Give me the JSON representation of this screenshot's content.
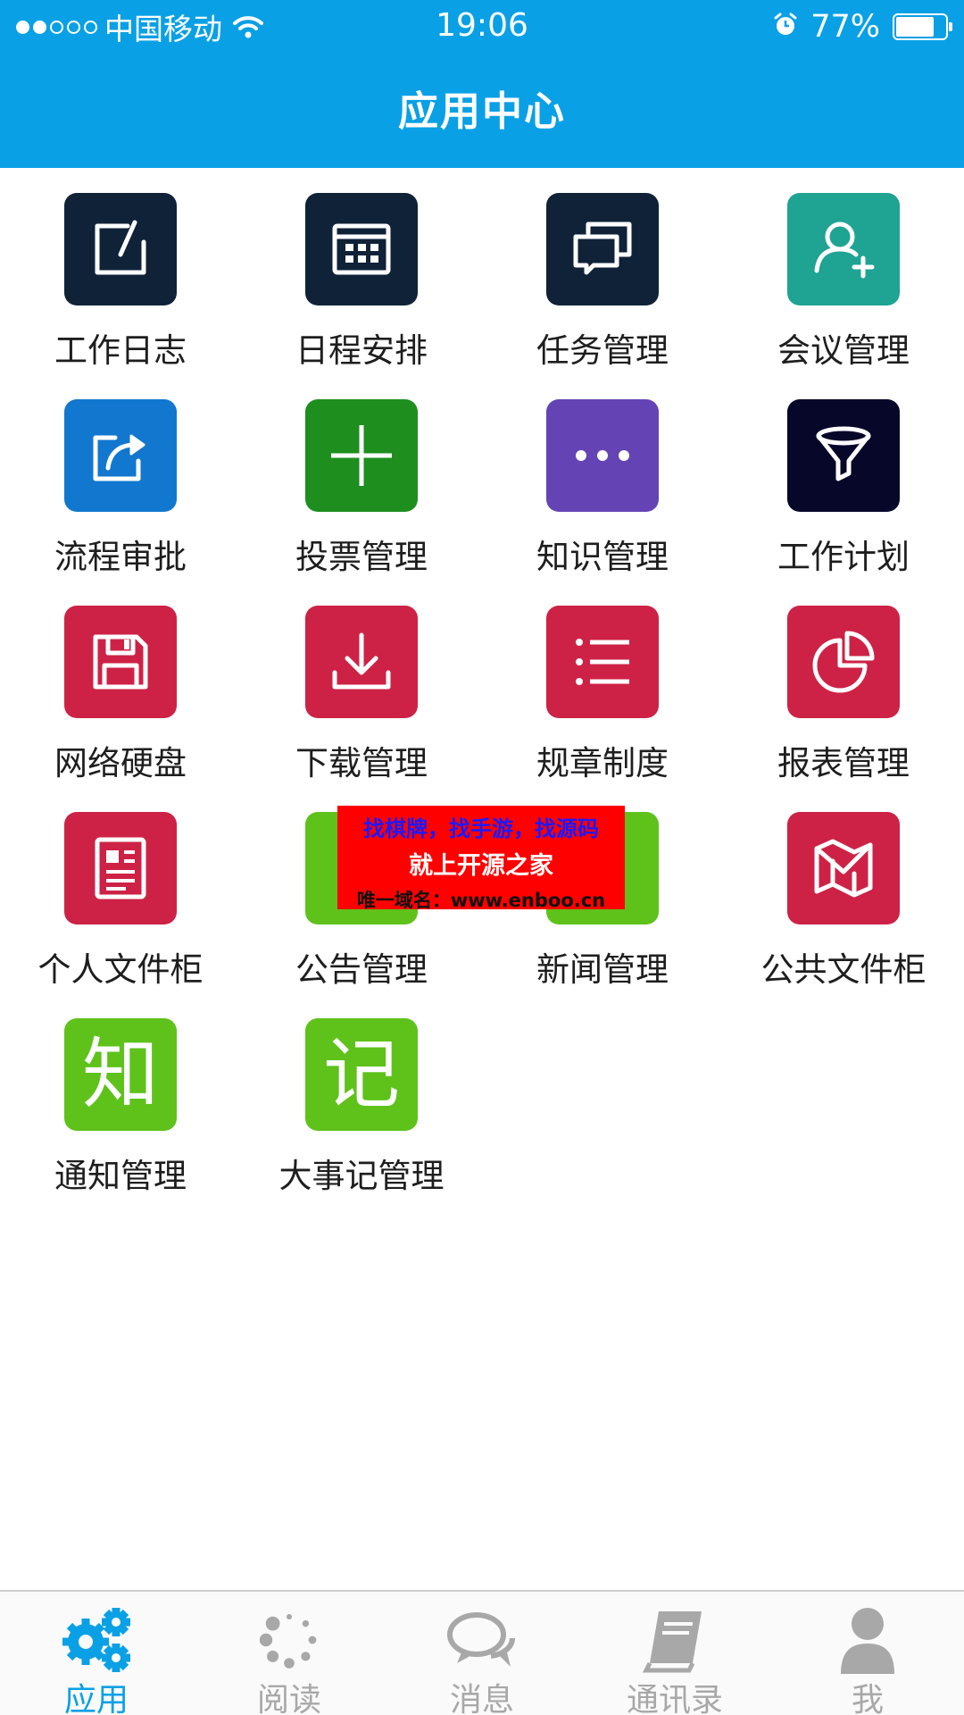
{
  "status_bar": {
    "carrier": "中国移动",
    "time": "19:06",
    "battery_percent": "77%",
    "battery_level": 0.77
  },
  "header": {
    "title": "应用中心"
  },
  "apps": [
    {
      "label": "工作日志",
      "icon": "edit-icon",
      "color": "#0f2238"
    },
    {
      "label": "日程安排",
      "icon": "calendar-icon",
      "color": "#0f2238"
    },
    {
      "label": "任务管理",
      "icon": "chat-windows-icon",
      "color": "#0f2238"
    },
    {
      "label": "会议管理",
      "icon": "add-user-icon",
      "color": "#1fa393"
    },
    {
      "label": "流程审批",
      "icon": "share-icon",
      "color": "#1177cf"
    },
    {
      "label": "投票管理",
      "icon": "plus-icon",
      "color": "#1e8e1e"
    },
    {
      "label": "知识管理",
      "icon": "more-dots-icon",
      "color": "#6444b4"
    },
    {
      "label": "工作计划",
      "icon": "funnel-icon",
      "color": "#07072a"
    },
    {
      "label": "网络硬盘",
      "icon": "floppy-disk-icon",
      "color": "#cd2246"
    },
    {
      "label": "下载管理",
      "icon": "download-icon",
      "color": "#cd2246"
    },
    {
      "label": "规章制度",
      "icon": "list-icon",
      "color": "#cd2246"
    },
    {
      "label": "报表管理",
      "icon": "pie-chart-icon",
      "color": "#cd2246"
    },
    {
      "label": "个人文件柜",
      "icon": "document-icon",
      "color": "#cd2246"
    },
    {
      "label": "公告管理",
      "icon": "announcement-icon",
      "color": "#5ec21b"
    },
    {
      "label": "新闻管理",
      "icon": "news-icon",
      "color": "#5ec21b"
    },
    {
      "label": "公共文件柜",
      "icon": "map-icon",
      "color": "#cd2246"
    },
    {
      "label": "通知管理",
      "icon": "zhi-char-icon",
      "glyph": "知",
      "color": "#5ec21b"
    },
    {
      "label": "大事记管理",
      "icon": "ji-char-icon",
      "glyph": "记",
      "color": "#5ec21b"
    }
  ],
  "banner": {
    "line1": "找棋牌，找手游，找源码",
    "line2": "就上开源之家",
    "line3": "唯一域名：www.enboo.cn"
  },
  "tabbar": {
    "active_color": "#0aa0e6",
    "inactive_color": "#a8a8a8",
    "items": [
      {
        "label": "应用",
        "icon": "gears-icon",
        "active": true
      },
      {
        "label": "阅读",
        "icon": "loading-dots-icon",
        "active": false
      },
      {
        "label": "消息",
        "icon": "chat-bubbles-icon",
        "active": false
      },
      {
        "label": "通讯录",
        "icon": "address-book-icon",
        "active": false
      },
      {
        "label": "我",
        "icon": "person-icon",
        "active": false
      }
    ]
  }
}
